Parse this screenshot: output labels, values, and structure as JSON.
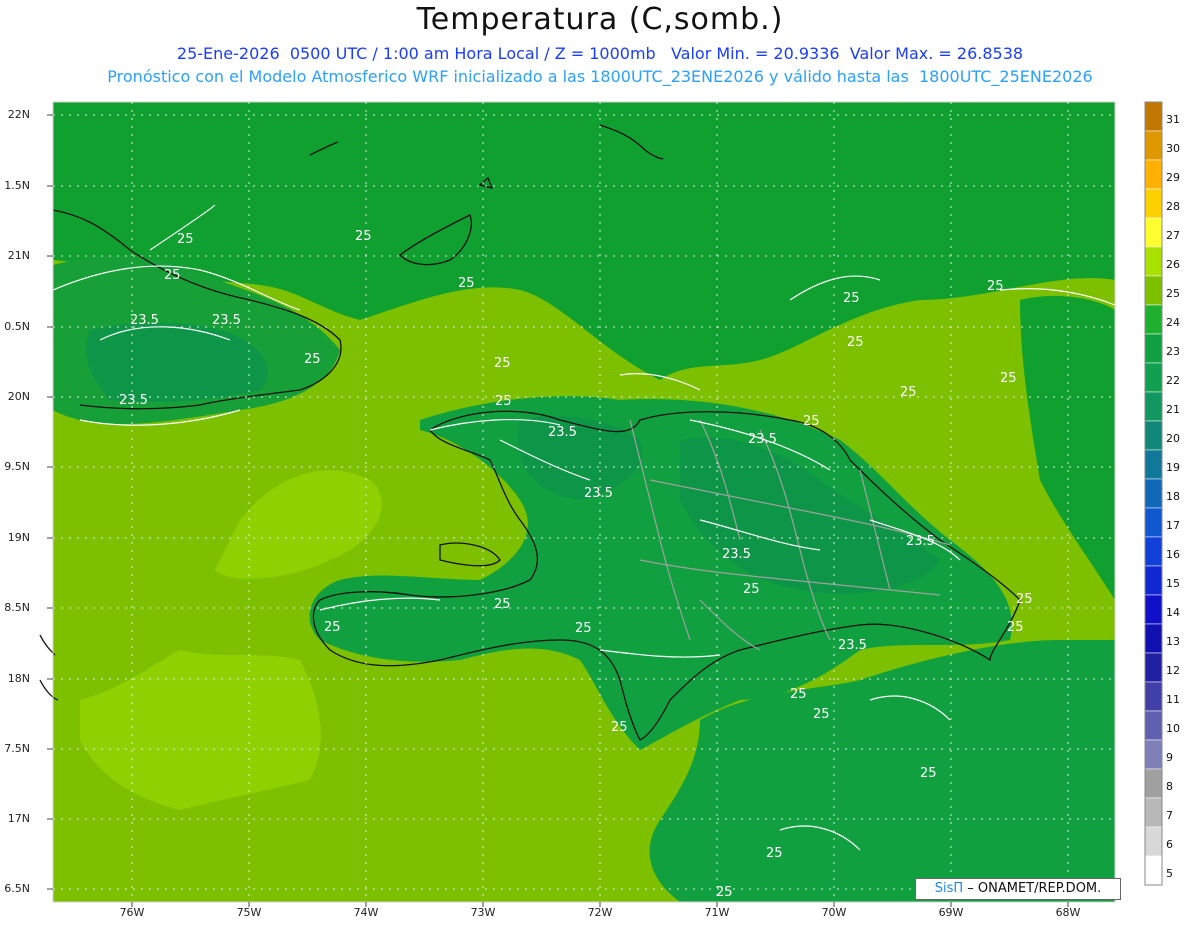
{
  "title": "Temperatura (C,somb.)",
  "subtitle_line1": "25-Ene-2026  0500 UTC / 1:00 am Hora Local / Z = 1000mb   Valor Min. = 20.9336  Valor Max. = 26.8538",
  "subtitle_line2": "Pronóstico con el Modelo Atmosferico WRF inicializado a las 1800UTC_23ENE2026 y válido hasta las  1800UTC_25ENE2026",
  "lat_ticks": [
    "22N",
    "1.5N",
    "21N",
    "0.5N",
    "20N",
    "9.5N",
    "19N",
    "8.5N",
    "18N",
    "7.5N",
    "17N",
    "6.5N"
  ],
  "lon_ticks": [
    "76W",
    "75W",
    "74W",
    "73W",
    "72W",
    "71W",
    "70W",
    "69W",
    "68W"
  ],
  "contour_labels": [
    "25",
    "25",
    "25",
    "23.5",
    "23.5",
    "25",
    "23.5",
    "25",
    "25",
    "23.5",
    "23.5",
    "25",
    "23.5",
    "25",
    "25",
    "25",
    "23.5",
    "25",
    "25",
    "25",
    "25",
    "25",
    "25",
    "25",
    "25",
    "23.5",
    "25",
    "25"
  ],
  "colorbar": {
    "labels": [
      "31",
      "30",
      "29",
      "28",
      "27",
      "26",
      "25",
      "24",
      "23",
      "22",
      "21",
      "20",
      "19",
      "18",
      "17",
      "16",
      "15",
      "14",
      "13",
      "12",
      "11",
      "10",
      "9",
      "8",
      "7",
      "6",
      "5"
    ],
    "colors": [
      "#c07800",
      "#e09800",
      "#ffb000",
      "#ffd000",
      "#ffff30",
      "#a8e000",
      "#7cc000",
      "#20b030",
      "#10a040",
      "#10a050",
      "#109860",
      "#108878",
      "#107898",
      "#1068b8",
      "#1058d0",
      "#1040d8",
      "#1028d0",
      "#1010c8",
      "#1010b0",
      "#2020a0",
      "#4040a8",
      "#6060b0",
      "#8080b8",
      "#a0a0a0",
      "#b8b8b8",
      "#d8d8d8",
      "#ffffff"
    ]
  },
  "credit": {
    "brand": "SisΠ",
    "text": " – ONAMET/REP.DOM."
  }
}
